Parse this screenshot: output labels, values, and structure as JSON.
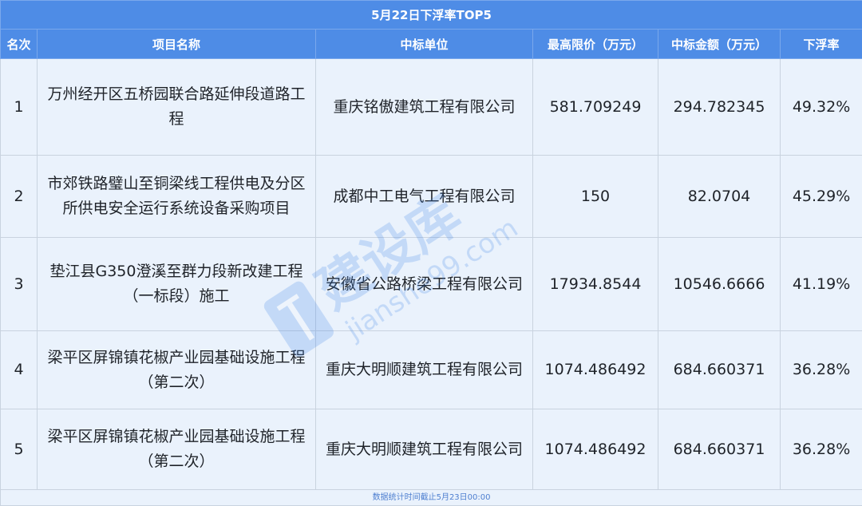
{
  "table": {
    "title": "5月22日下浮率TOP5",
    "headers": [
      "名次",
      "项目名称",
      "中标单位",
      "最高限价（万元）",
      "中标金额（万元）",
      "下浮率"
    ],
    "rows": [
      {
        "rank": "1",
        "project": "万州经开区五桥园联合路延伸段道路工程",
        "winner": "重庆铭傲建筑工程有限公司",
        "max_price": "581.709249",
        "bid_amount": "294.782345",
        "discount": "49.32%"
      },
      {
        "rank": "2",
        "project": "市郊铁路璧山至铜梁线工程供电及分区所供电安全运行系统设备采购项目",
        "winner": "成都中工电气工程有限公司",
        "max_price": "150",
        "bid_amount": "82.0704",
        "discount": "45.29%"
      },
      {
        "rank": "3",
        "project": "垫江县G350澄溪至群力段新改建工程（一标段）施工",
        "winner": "安徽省公路桥梁工程有限公司",
        "max_price": "17934.8544",
        "bid_amount": "10546.6666",
        "discount": "41.19%"
      },
      {
        "rank": "4",
        "project": "梁平区屏锦镇花椒产业园基础设施工程（第二次）",
        "winner": "重庆大明顺建筑工程有限公司",
        "max_price": "1074.486492",
        "bid_amount": "684.660371",
        "discount": "36.28%"
      },
      {
        "rank": "5",
        "project": "梁平区屏锦镇花椒产业园基础设施工程（第二次）",
        "winner": "重庆大明顺建筑工程有限公司",
        "max_price": "1074.486492",
        "bid_amount": "684.660371",
        "discount": "36.28%"
      }
    ],
    "footer": "数据统计时间截止5月23日00:00"
  },
  "watermark": {
    "text": "建设库",
    "url": "jianshe99.com"
  },
  "colors": {
    "header_bg": "#4e8ce6",
    "row_bg": "#eaf2fc",
    "border": "#c9d3df",
    "footer_text": "#4e7fd0",
    "watermark": "#3c82e6"
  }
}
